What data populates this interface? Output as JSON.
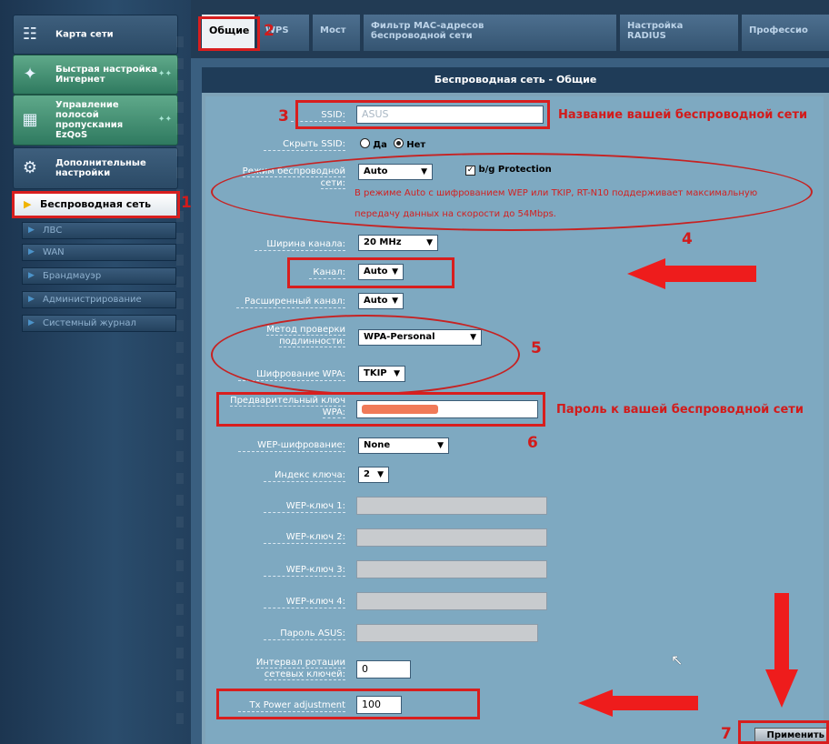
{
  "sidebar": {
    "items": [
      {
        "label": "Карта сети",
        "icon": "network-map-icon"
      },
      {
        "label": "Быстрая настройка Интернет",
        "icon": "wand-icon"
      },
      {
        "label": "Управление полосой пропускания EzQoS",
        "icon": "qos-icon"
      },
      {
        "label": "Дополнительные настройки",
        "icon": "tools-icon"
      }
    ],
    "active_sub": "Беспроводная сеть",
    "subnav": [
      "ЛВС",
      "WAN",
      "Брандмауэр",
      "Администрирование",
      "Системный журнал"
    ]
  },
  "tabs": [
    {
      "label": "Общие"
    },
    {
      "label": "WPS"
    },
    {
      "label": "Мост"
    },
    {
      "label": "Фильтр MAC-адресов беспроводной сети"
    },
    {
      "label": "Настройка RADIUS"
    },
    {
      "label": "Профессио"
    }
  ],
  "panel": {
    "title": "Беспроводная сеть - Общие"
  },
  "form": {
    "ssid_label": "SSID:",
    "ssid_value": "ASUS",
    "hide_ssid_label": "Скрыть SSID:",
    "hide_yes": "Да",
    "hide_no": "Нет",
    "mode_label": "Режим беспроводной сети:",
    "mode_value": "Auto",
    "bg_protection": "b/g Protection",
    "mode_note_1": "В режиме Auto с шифрованием WEP или TKIP, RT-N10 поддерживает максимальную",
    "mode_note_2": "передачу данных на скорости до 54Mbps.",
    "width_label": "Ширина канала:",
    "width_value": "20 MHz",
    "channel_label": "Канал:",
    "channel_value": "Auto",
    "ext_channel_label": "Расширенный канал:",
    "ext_channel_value": "Auto",
    "auth_label": "Метод проверки подлинности:",
    "auth_value": "WPA-Personal",
    "wpa_enc_label": "Шифрование WPA:",
    "wpa_enc_value": "TKIP",
    "psk_label": "Предварительный ключ WPA:",
    "wep_enc_label": "WEP-шифрование:",
    "wep_enc_value": "None",
    "key_index_label": "Индекс ключа:",
    "key_index_value": "2",
    "wep_key1": "WEP-ключ 1:",
    "wep_key2": "WEP-ключ 2:",
    "wep_key3": "WEP-ключ 3:",
    "wep_key4": "WEP-ключ 4:",
    "asus_pass_label": "Пароль ASUS:",
    "rotation_label": "Интервал ротации сетевых ключей:",
    "rotation_value": "0",
    "tx_label": "Tx Power adjustment",
    "tx_value": "100",
    "apply": "Применить"
  },
  "annotations": {
    "n1": "1",
    "n2": "2",
    "n3": "3",
    "n4": "4",
    "n5": "5",
    "n6": "6",
    "n7": "7",
    "ssid_note": "Название вашей беспроводной сети",
    "psk_note": "Пароль к вашей беспроводной сети",
    "arrow_color": "#ee1c1c",
    "box_color": "#d81e1e"
  }
}
